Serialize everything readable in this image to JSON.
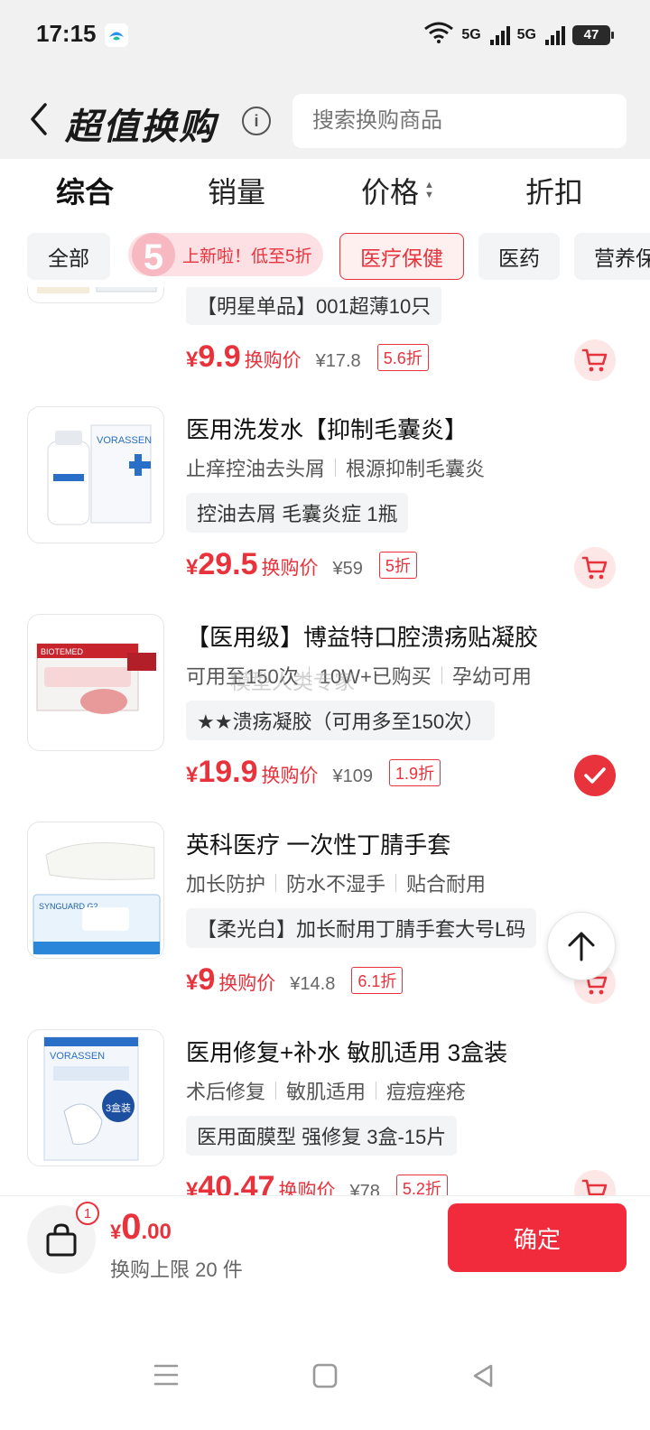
{
  "status_bar": {
    "time": "17:15",
    "network_1": "5G",
    "network_2": "5G",
    "battery": "47",
    "icons": [
      "app-notification-icon",
      "wifi-icon",
      "signal-icon",
      "battery-icon"
    ]
  },
  "header": {
    "title": "超值换购",
    "search_placeholder": "搜索换购商品"
  },
  "sort_tabs": [
    {
      "label": "综合",
      "active": true
    },
    {
      "label": "销量",
      "active": false
    },
    {
      "label": "价格",
      "active": false
    },
    {
      "label": "折扣",
      "active": false
    }
  ],
  "chips": {
    "all": "全部",
    "promo": "上新啦！低至5折",
    "promo_badge": "5",
    "medical_care": "医疗保健",
    "medicine": "医药",
    "nutrition": "营养保"
  },
  "products": [
    {
      "title": "",
      "features": [],
      "spec": "【明星单品】001超薄10只",
      "currency": "¥",
      "price": "9.9",
      "price_label": "换购价",
      "original_price": "¥17.8",
      "discount": "5.6折",
      "action": "cart"
    },
    {
      "title": "医用洗发水【抑制毛囊炎】",
      "features": [
        "止痒控油去头屑",
        "根源抑制毛囊炎"
      ],
      "spec": "控油去屑 毛囊炎症 1瓶",
      "currency": "¥",
      "price": "29.5",
      "price_label": "换购价",
      "original_price": "¥59",
      "discount": "5折",
      "action": "cart",
      "image_brand": "VORASSEN"
    },
    {
      "title": "【医用级】博益特口腔溃疡贴凝胶",
      "features": [
        "可用至150次",
        "10W+已购买",
        "孕幼可用"
      ],
      "spec": "★★溃疡凝胶（可用多至150次）",
      "currency": "¥",
      "price": "19.9",
      "price_label": "换购价",
      "original_price": "¥109",
      "discount": "1.9折",
      "action": "selected",
      "image_brand": "BIOTEMED"
    },
    {
      "title": "英科医疗 一次性丁腈手套",
      "features": [
        "加长防护",
        "防水不湿手",
        "贴合耐用"
      ],
      "spec": "【柔光白】加长耐用丁腈手套大号L码",
      "currency": "¥",
      "price": "9",
      "price_label": "换购价",
      "original_price": "¥14.8",
      "discount": "6.1折",
      "action": "cart",
      "image_brand": "SYNGUARD G2"
    },
    {
      "title": "医用修复+补水 敏肌适用 3盒装",
      "features": [
        "术后修复",
        "敏肌适用",
        "痘痘痤疮"
      ],
      "spec": "医用面膜型 强修复 3盒-15片",
      "currency": "¥",
      "price": "40.47",
      "price_label": "换购价",
      "original_price": "¥78",
      "discount": "5.2折",
      "action": "cart",
      "image_brand": "VORASSEN",
      "image_badge": "3盒装"
    }
  ],
  "overlay_text": "模型人类专家",
  "bottom_bar": {
    "cart_count": "1",
    "currency": "¥",
    "total_int": "0",
    "total_dec": ".00",
    "limit_text": "换购上限 20 件",
    "confirm_label": "确定"
  },
  "colors": {
    "accent": "#e8323c",
    "confirm": "#f22b3c",
    "header_bg": "#f1f1f1",
    "chip_bg": "#f3f4f6"
  }
}
